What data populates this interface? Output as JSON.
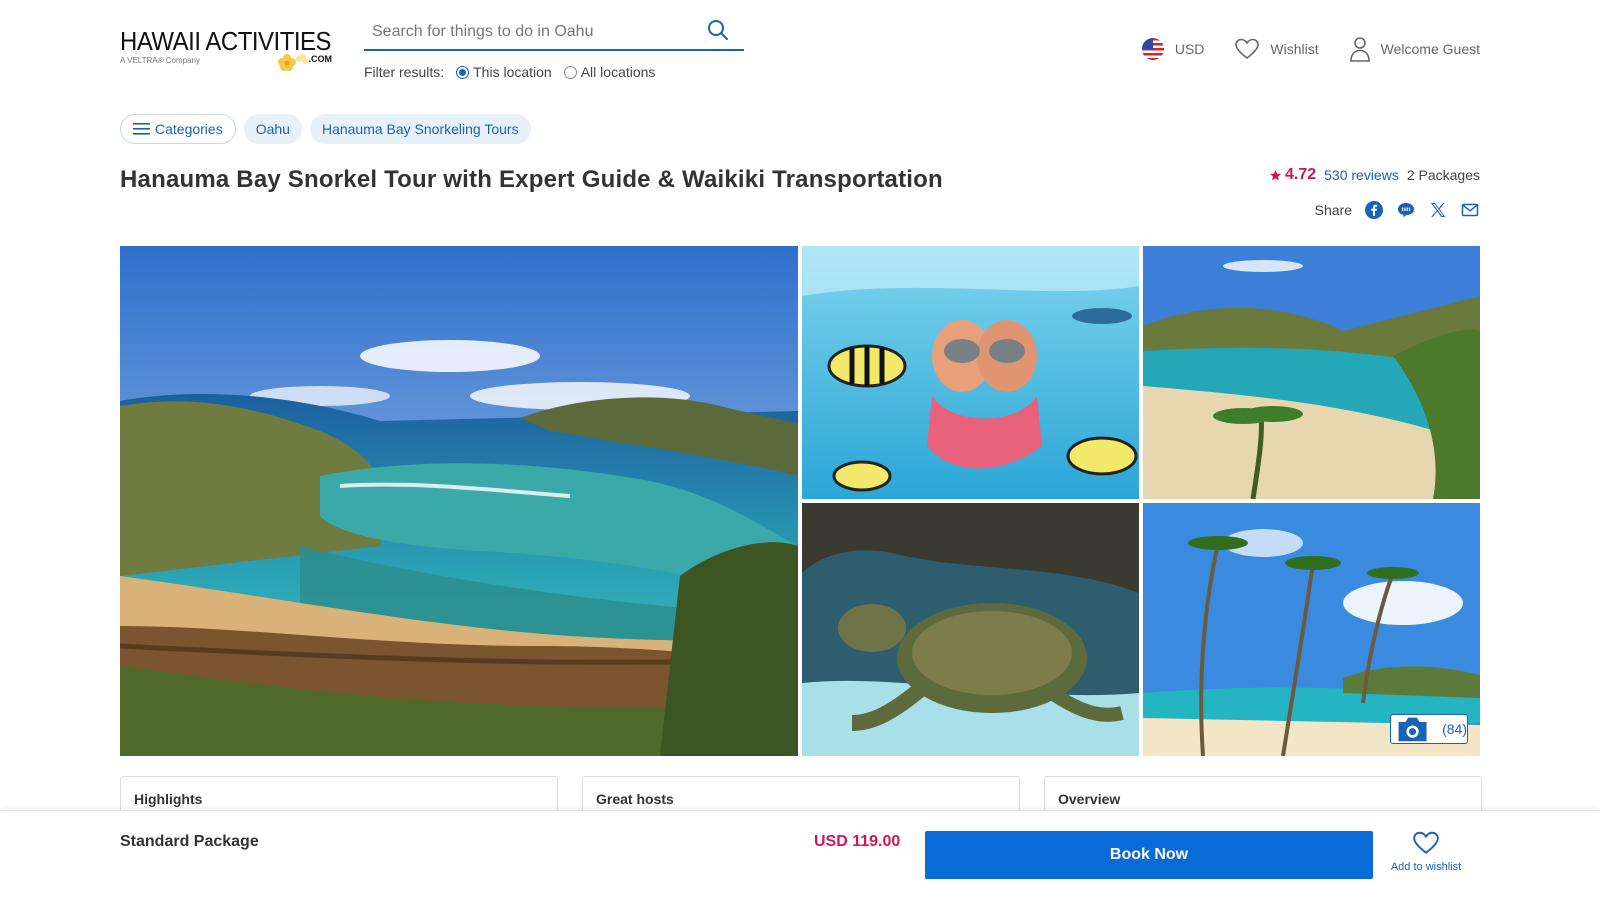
{
  "header": {
    "logo": {
      "main": "HAWAII ACTIVITIES",
      "sub": "A VELTRA® Company",
      "com": ".COM"
    },
    "search": {
      "placeholder": "Search for things to do in Oahu",
      "value": ""
    },
    "filter": {
      "label": "Filter results:",
      "options": [
        {
          "label": "This location",
          "selected": true
        },
        {
          "label": "All locations",
          "selected": false
        }
      ]
    },
    "nav": {
      "currency": "USD",
      "wishlist": "Wishlist",
      "account": "Welcome Guest"
    }
  },
  "breadcrumbs": {
    "categories": "Categories",
    "items": [
      "Oahu",
      "Hanauma Bay Snorkeling Tours"
    ]
  },
  "activity": {
    "title": "Hanauma Bay Snorkel Tour with Expert Guide & Waikiki Transportation",
    "rating": "4.72",
    "reviews": "530 reviews",
    "packages": "2 Packages",
    "share_label": "Share"
  },
  "gallery": {
    "photo_count": "(84)"
  },
  "cards": {
    "highlights": "Highlights",
    "hosts": "Great hosts",
    "overview": "Overview"
  },
  "booking": {
    "package": "Standard Package",
    "price": "USD 119.00",
    "book_label": "Book Now",
    "wishlist_label": "Add to wishlist"
  },
  "colors": {
    "brand_blue": "#0a6ad8",
    "link_blue": "#1a62b8",
    "accent_pink": "#d4145a"
  }
}
